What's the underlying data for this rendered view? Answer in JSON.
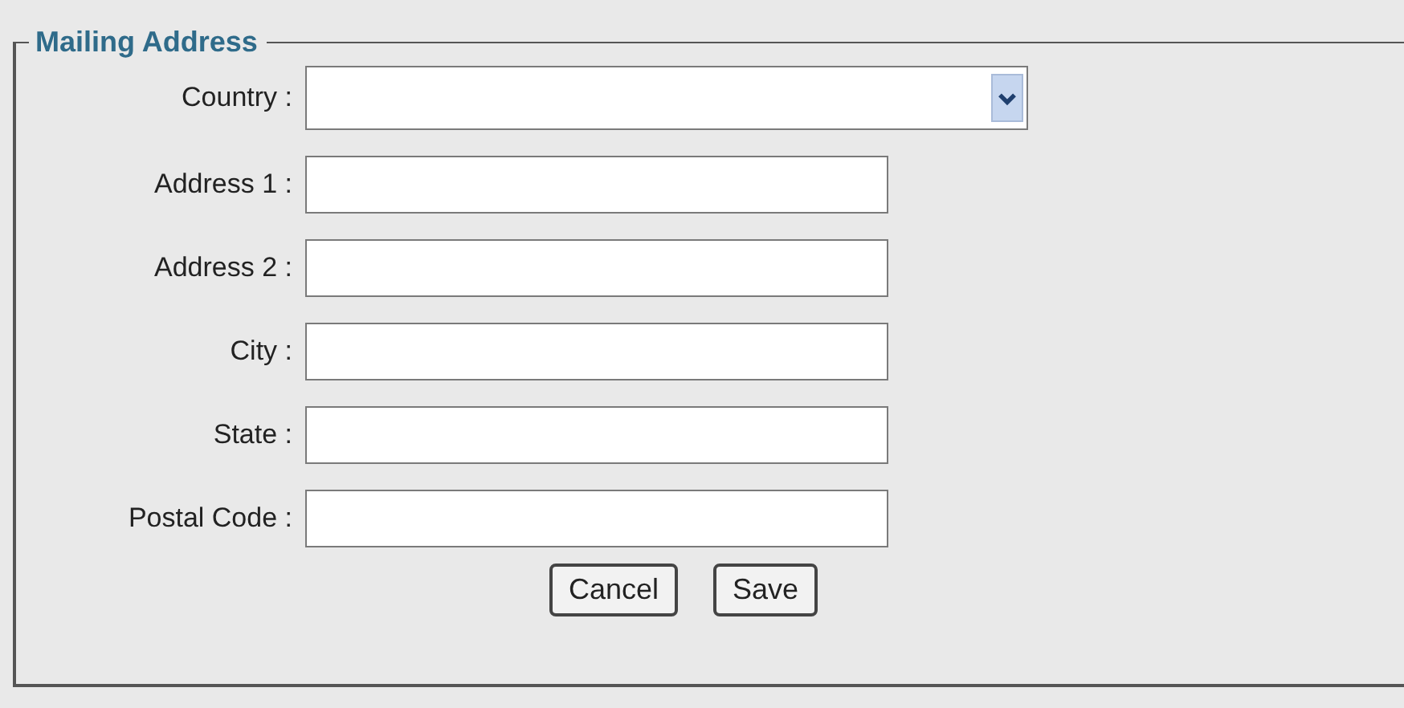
{
  "section": {
    "title": "Mailing Address"
  },
  "fields": [
    {
      "kind": "select",
      "label": "Country :"
    },
    {
      "kind": "text",
      "label": "Address 1 :"
    },
    {
      "kind": "text",
      "label": "Address 2 :"
    },
    {
      "kind": "text",
      "label": "City :"
    },
    {
      "kind": "text",
      "label": "State :"
    },
    {
      "kind": "text",
      "label": "Postal Code :"
    }
  ],
  "buttons": [
    "Cancel",
    "Save"
  ]
}
